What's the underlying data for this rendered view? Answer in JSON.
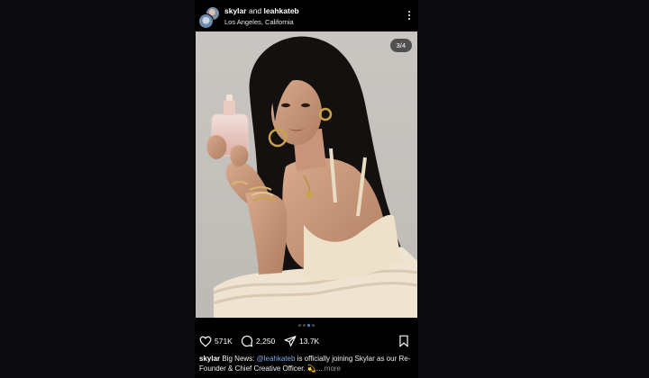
{
  "header": {
    "user1": "skylar",
    "joiner": "and",
    "user2": "leahkateb",
    "location": "Los Angeles, California"
  },
  "photo": {
    "counter": "3/4"
  },
  "carousel": {
    "count": 4,
    "active_index": 2
  },
  "actions": {
    "likes": "571K",
    "comments": "2,250",
    "shares": "13.7K"
  },
  "caption": {
    "user": "skylar",
    "text_before": "Big News: ",
    "mention": "@leahkateb",
    "text_after": " is officially joining Skylar as our Re-Founder & Chief Creative Officer. 💫...",
    "more": "more"
  },
  "colors": {
    "mention": "#7fa7e8",
    "active_dot": "#3897f0",
    "background": "#0b0b0d"
  }
}
